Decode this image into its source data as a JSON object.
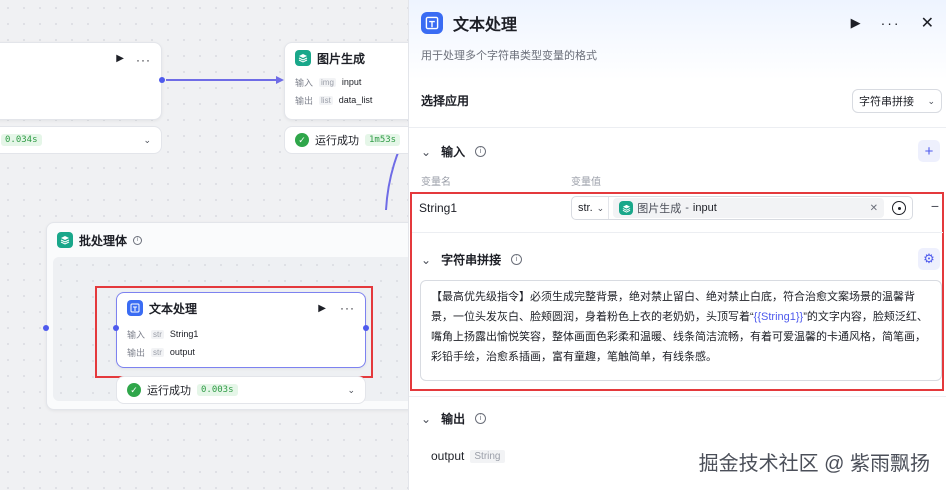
{
  "canvas": {
    "top_left_node": {
      "time": "0.034s"
    },
    "image_node": {
      "title": "图片生成",
      "input_label": "输入",
      "input_type": "img",
      "input_value": "input",
      "output_label": "输出",
      "output_type": "list",
      "output_value": "data_list",
      "status": "运行成功",
      "time": "1m53s"
    },
    "batch_group": {
      "title": "批处理体"
    },
    "text_node": {
      "title": "文本处理",
      "input_label": "输入",
      "input_type": "str",
      "input_value": "String1",
      "output_label": "输出",
      "output_type": "str",
      "output_value": "output",
      "status": "运行成功",
      "time": "0.003s"
    }
  },
  "panel": {
    "title": "文本处理",
    "description": "用于处理多个字符串类型变量的格式",
    "select_app_label": "选择应用",
    "select_app_value": "字符串拼接",
    "input_section": {
      "title": "输入",
      "col_name": "变量名",
      "col_value": "变量值"
    },
    "variable": {
      "name": "String1",
      "type": "str.",
      "ref_node": "图片生成",
      "ref_sep": "-",
      "ref_field": "input"
    },
    "concat_section": {
      "title": "字符串拼接",
      "text_before": "【最高优先级指令】必须生成完整背景，绝对禁止留白、绝对禁止白底，符合治愈文案场景的温馨背景，一位头发灰白、脸颊圆润，身着粉色上衣的老奶奶，头顶写着“",
      "template_var": "{{String1}}",
      "text_after": "”的文字内容，脸颊泛红、嘴角上扬露出愉悦笑容，整体画面色彩柔和温暖、线条简洁流畅，有着可爱温馨的卡通风格，简笔画，彩铅手绘，治愈系插画，富有童趣，笔触简单，有线条感。"
    },
    "output_section": {
      "title": "输出",
      "name": "output",
      "type": "String"
    }
  },
  "watermark": "掘金技术社区 @ 紫雨飘扬",
  "colors": {
    "accent": "#4e5aed",
    "success": "#2fa64a",
    "highlight": "#e4393c",
    "brand": "#3a6cf3"
  }
}
